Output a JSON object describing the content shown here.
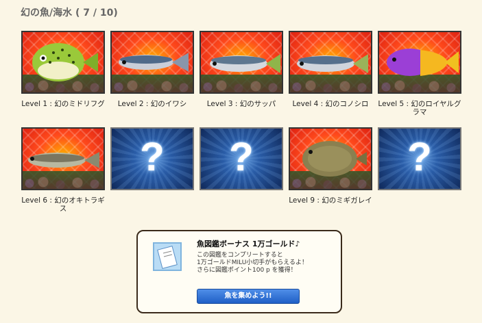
{
  "page": {
    "title": "幻の魚/海水 ( 7 / 10)"
  },
  "fish_cards": [
    {
      "caption": "Level 1 : 幻のミドリフグ",
      "state": "found",
      "icon": "pufferfish"
    },
    {
      "caption": "Level 2 : 幻のイワシ",
      "state": "found",
      "icon": "sardine"
    },
    {
      "caption": "Level 3 : 幻のサッパ",
      "state": "found",
      "icon": "herring"
    },
    {
      "caption": "Level 4 : 幻のコノシロ",
      "state": "found",
      "icon": "gizzard-shad"
    },
    {
      "caption": "Level 5 : 幻のロイヤルグラマ",
      "state": "found",
      "icon": "royal-gramma"
    },
    {
      "caption": "Level 6 : 幻のオキトラギス",
      "state": "found",
      "icon": "weever"
    },
    {
      "caption": "",
      "state": "locked",
      "mark": "?"
    },
    {
      "caption": "",
      "state": "locked",
      "mark": "?"
    },
    {
      "caption": "Level 9 : 幻のミギガレイ",
      "state": "found",
      "icon": "flounder"
    },
    {
      "caption": "",
      "state": "locked",
      "mark": "?"
    }
  ],
  "bonus": {
    "title": "魚図鑑ボーナス 1万ゴールド♪",
    "line1": "この図鑑をコンプリートすると",
    "line2": "1万ゴールドMILU小切手がもらえるよ！",
    "line3": "さらに図鑑ポイント100 p を獲得！",
    "button_label": "魚を集めよう!!",
    "icon": "cheque-icon"
  }
}
